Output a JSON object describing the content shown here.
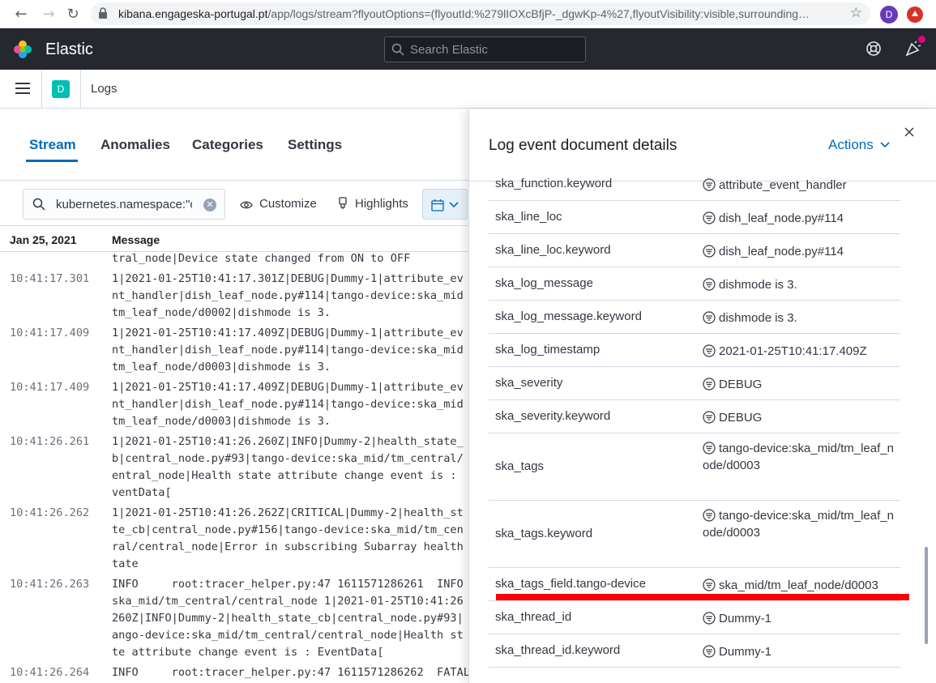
{
  "browser": {
    "url_host": "kibana.engageska-portugal.pt",
    "url_path": "/app/logs/stream?flyoutOptions=(flyoutId:%279lIOXcBfjP-_dgwKp-4%27,flyoutVisibility:visible,surrounding…",
    "profile_initial": "D"
  },
  "header": {
    "brand": "Elastic",
    "search_placeholder": "Search Elastic"
  },
  "subbar": {
    "space_initial": "D",
    "breadcrumb": "Logs"
  },
  "tabs": [
    {
      "label": "Stream",
      "active": true
    },
    {
      "label": "Anomalies",
      "active": false
    },
    {
      "label": "Categories",
      "active": false
    },
    {
      "label": "Settings",
      "active": false
    }
  ],
  "toolbar": {
    "query": "kubernetes.namespace:\"c",
    "customize_label": "Customize",
    "highlights_label": "Highlights"
  },
  "log_table": {
    "date_header": "Jan 25, 2021",
    "message_header": "Message",
    "rows": [
      {
        "time": "",
        "lines": [
          "tral_node|Device state changed from ON to OFF"
        ]
      },
      {
        "time": "10:41:17.301",
        "lines": [
          "1|2021-01-25T10:41:17.301Z|DEBUG|Dummy-1|attribute_ev",
          "nt_handler|dish_leaf_node.py#114|tango-device:ska_mid",
          "tm_leaf_node/d0002|dishmode is 3."
        ]
      },
      {
        "time": "10:41:17.409",
        "lines": [
          "1|2021-01-25T10:41:17.409Z|DEBUG|Dummy-1|attribute_ev",
          "nt_handler|dish_leaf_node.py#114|tango-device:ska_mid",
          "tm_leaf_node/d0003|dishmode is 3."
        ]
      },
      {
        "time": "10:41:17.409",
        "lines": [
          "1|2021-01-25T10:41:17.409Z|DEBUG|Dummy-1|attribute_ev",
          "nt_handler|dish_leaf_node.py#114|tango-device:ska_mid",
          "tm_leaf_node/d0003|dishmode is 3."
        ]
      },
      {
        "time": "10:41:26.261",
        "lines": [
          "1|2021-01-25T10:41:26.260Z|INFO|Dummy-2|health_state_",
          "b|central_node.py#93|tango-device:ska_mid/tm_central/",
          "entral_node|Health state attribute change event is :",
          "ventData["
        ]
      },
      {
        "time": "10:41:26.262",
        "lines": [
          "1|2021-01-25T10:41:26.262Z|CRITICAL|Dummy-2|health_st",
          "te_cb|central_node.py#156|tango-device:ska_mid/tm_cen",
          "ral/central_node|Error in subscribing Subarray health",
          "tate"
        ]
      },
      {
        "time": "10:41:26.263",
        "lines": [
          "INFO     root:tracer_helper.py:47 1611571286261  INFO",
          "ska_mid/tm_central/central_node 1|2021-01-25T10:41:26",
          "260Z|INFO|Dummy-2|health_state_cb|central_node.py#93|",
          "ango-device:ska_mid/tm_central/central_node|Health st",
          "te attribute change event is : EventData["
        ]
      },
      {
        "time": "10:41:26.264",
        "lines": [
          "INFO     root:tracer_helper.py:47 1611571286262  FATAL"
        ]
      }
    ]
  },
  "flyout": {
    "title": "Log event document details",
    "actions_label": "Actions",
    "fields": [
      {
        "name": "ska_function.keyword",
        "value": "attribute_event_handler"
      },
      {
        "name": "ska_line_loc",
        "value": "dish_leaf_node.py#114"
      },
      {
        "name": "ska_line_loc.keyword",
        "value": "dish_leaf_node.py#114"
      },
      {
        "name": "ska_log_message",
        "value": "dishmode is 3."
      },
      {
        "name": "ska_log_message.keyword",
        "value": "dishmode is 3."
      },
      {
        "name": "ska_log_timestamp",
        "value": "2021-01-25T10:41:17.409Z"
      },
      {
        "name": "ska_severity",
        "value": "DEBUG"
      },
      {
        "name": "ska_severity.keyword",
        "value": "DEBUG"
      },
      {
        "name": "ska_tags",
        "value": "tango-device:ska_mid/tm_leaf_node/d0003"
      },
      {
        "name": "ska_tags.keyword",
        "value": "tango-device:ska_mid/tm_leaf_node/d0003"
      },
      {
        "name": "ska_tags_field.tango-device",
        "value": "ska_mid/tm_leaf_node/d0003"
      },
      {
        "name": "ska_thread_id",
        "value": "Dummy-1"
      },
      {
        "name": "ska_thread_id.keyword",
        "value": "Dummy-1"
      }
    ]
  },
  "colors": {
    "accent": "#006bb8",
    "header_bg": "#25282f",
    "highlight": "#ff0000"
  }
}
